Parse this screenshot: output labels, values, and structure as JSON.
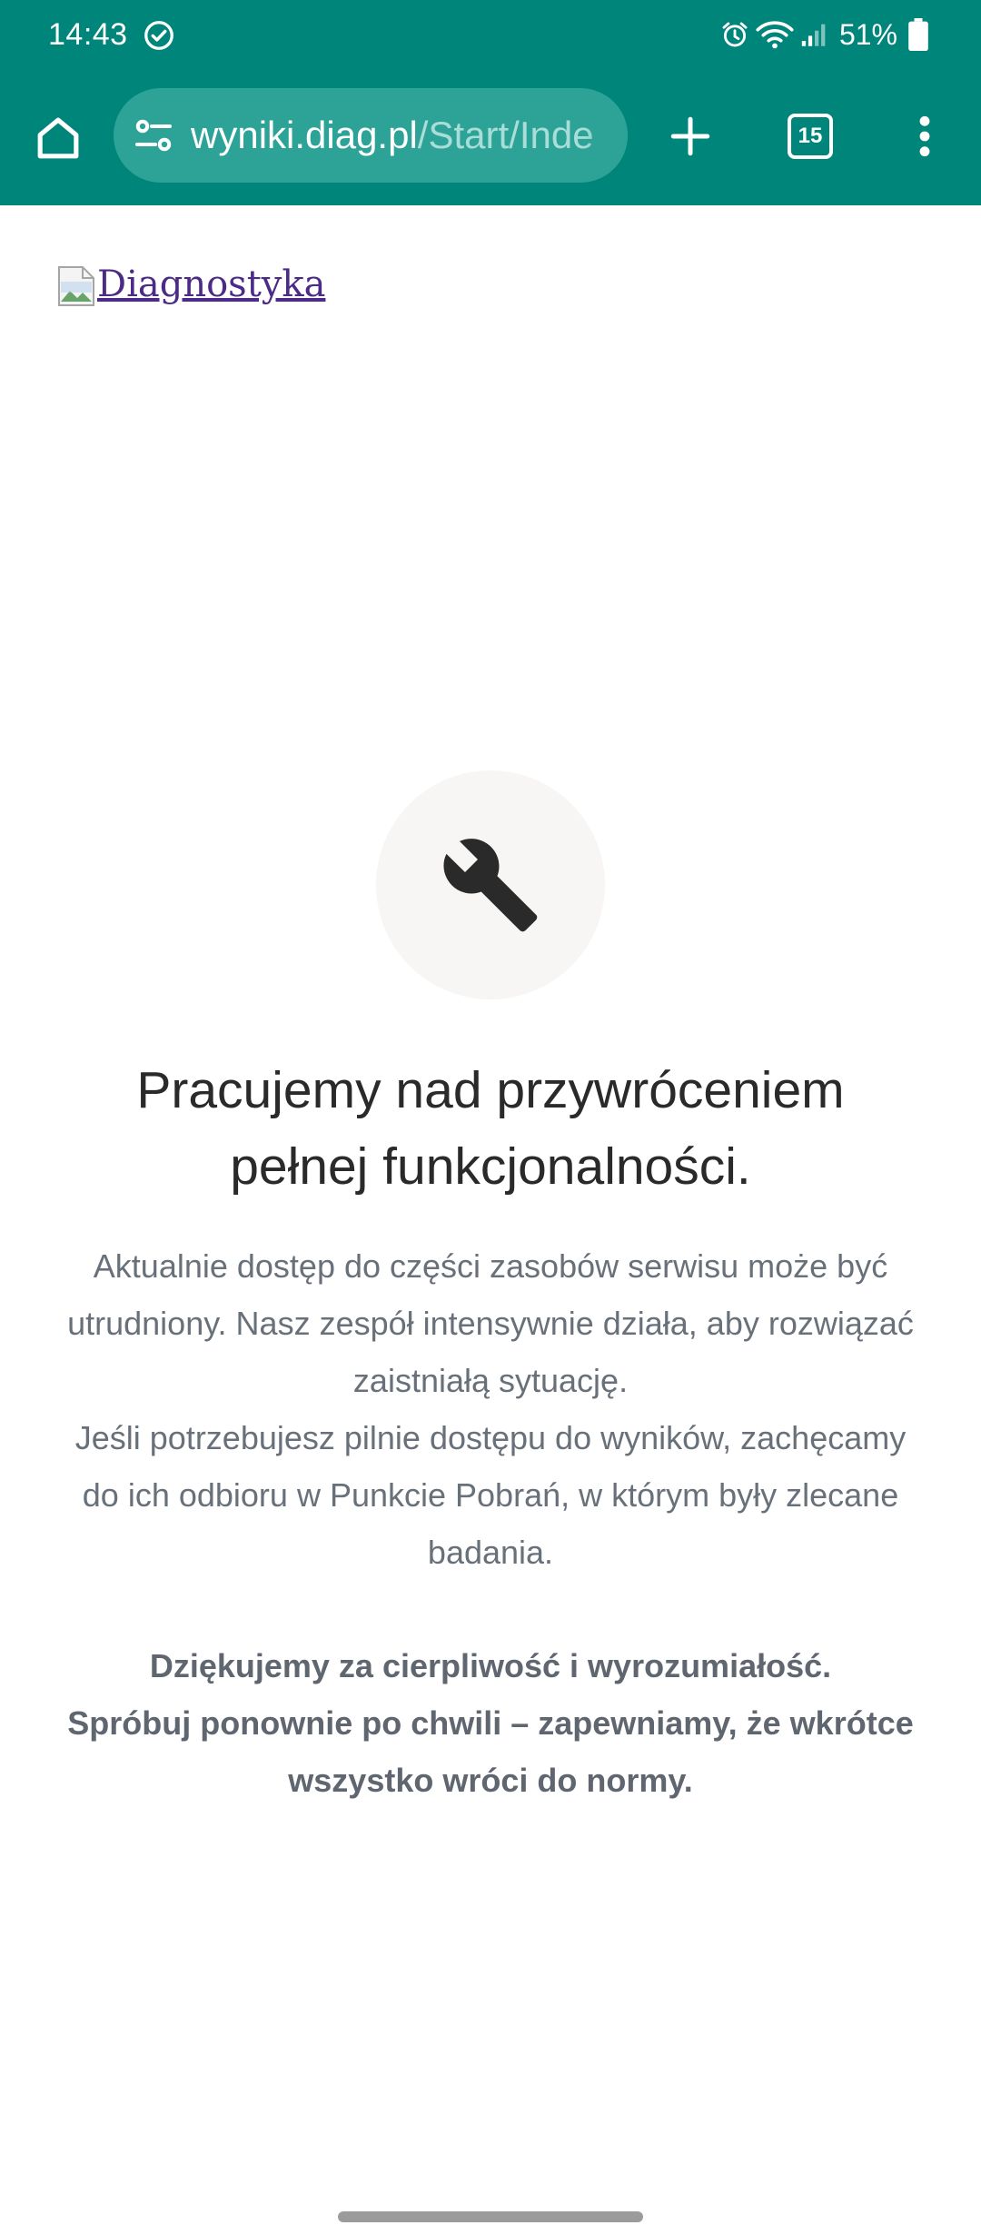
{
  "status_bar": {
    "time": "14:43",
    "battery": "51%"
  },
  "browser": {
    "url_host": "wyniki.diag.pl",
    "url_path": "/Start/Inde",
    "tab_count": "15"
  },
  "page": {
    "logo_alt": "Diagnostyka",
    "heading_line1": "Pracujemy nad przywróceniem",
    "heading_line2": "pełnej funkcjonalności.",
    "paragraph1": "Aktualnie dostęp do części zasobów serwisu może być utrudniony. Nasz zespół intensywnie działa, aby rozwiązać zaistniałą sytuację.",
    "paragraph2": "Jeśli potrzebujesz pilnie dostępu do wyników, zachęcamy do ich odbioru w Punkcie Pobrań, w którym były zlecane badania.",
    "thanks_line1": "Dziękujemy za cierpliwość i wyrozumiałość.",
    "thanks_line2": "Spróbuj ponownie po chwili – zapewniamy, że wkrótce wszystko wróci do normy."
  },
  "icons": {
    "status": [
      "check-circle-icon",
      "alarm-icon",
      "wifi-icon",
      "signal-icon",
      "battery-icon"
    ],
    "toolbar": [
      "home-icon",
      "site-info-icon",
      "plus-icon",
      "tab-switcher-icon",
      "more-vert-icon"
    ],
    "page": [
      "broken-image-icon",
      "wrench-icon"
    ]
  },
  "colors": {
    "toolbar": "#00857a",
    "omnibox": "#2da398",
    "link": "#4b2b87",
    "heading": "#2a2a2a",
    "body_text": "#68707a"
  }
}
